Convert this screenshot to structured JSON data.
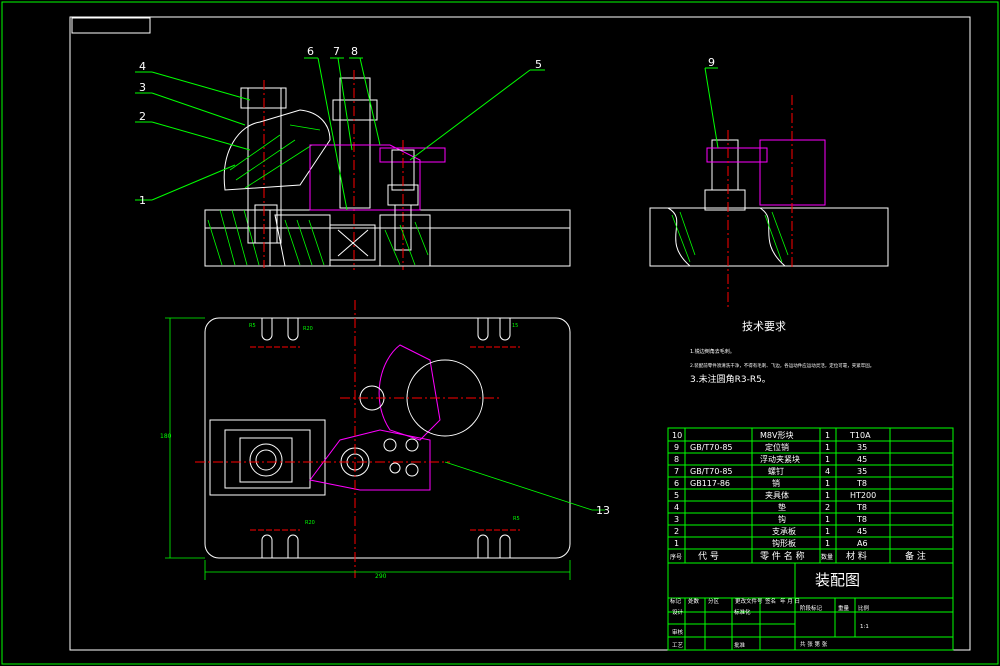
{
  "drawing_title": "装配图",
  "balloons": [
    "1",
    "2",
    "3",
    "4",
    "5",
    "6",
    "7",
    "8",
    "9",
    "13"
  ],
  "tech_requirements": {
    "heading": "技术要求",
    "items": [
      "1.锐边倒角去毛刺。",
      "2.装配前零件须清洗干净，不得有毛刺、飞边，各运动件应运动灵活，定位可靠，夹紧牢固。",
      "3.未注圆角R3-R5。"
    ]
  },
  "dimensions": {
    "width": "290",
    "height": "180",
    "slot_a": "R5",
    "slot_b": "R20",
    "slot_c": "15"
  },
  "bom": {
    "rows": [
      {
        "no": "10",
        "code": "",
        "name": "M8V形块",
        "qty": "1",
        "material": "T10A",
        "note": ""
      },
      {
        "no": "9",
        "code": "GB/T70-85",
        "name": "定位销",
        "qty": "1",
        "material": "35",
        "note": ""
      },
      {
        "no": "8",
        "code": "",
        "name": "浮动夹紧块",
        "qty": "1",
        "material": "45",
        "note": ""
      },
      {
        "no": "7",
        "code": "GB/T70-85",
        "name": "螺钉",
        "qty": "4",
        "material": "35",
        "note": ""
      },
      {
        "no": "6",
        "code": "GB117-86",
        "name": "销",
        "qty": "1",
        "material": "T8",
        "note": ""
      },
      {
        "no": "5",
        "code": "",
        "name": "夹具体",
        "qty": "1",
        "material": "HT200",
        "note": ""
      },
      {
        "no": "4",
        "code": "",
        "name": "垫",
        "qty": "2",
        "material": "T8",
        "note": ""
      },
      {
        "no": "3",
        "code": "",
        "name": "钩",
        "qty": "1",
        "material": "T8",
        "note": ""
      },
      {
        "no": "2",
        "code": "",
        "name": "支承板",
        "qty": "1",
        "material": "45",
        "note": ""
      },
      {
        "no": "1",
        "code": "",
        "name": "钩形板",
        "qty": "1",
        "material": "A6",
        "note": ""
      }
    ],
    "header": {
      "no": "序号",
      "code": "代  号",
      "name": "零 件 名 称",
      "qty": "数量",
      "material": "材  料",
      "note": "备  注"
    }
  },
  "title_block": {
    "row1": [
      "标记",
      "处数",
      "分区",
      "更改文件号",
      "签名",
      "年 月 日"
    ],
    "design": "设计",
    "standard": "标准化",
    "check": "审核",
    "process": "工艺",
    "approve": "批准",
    "stage": "阶段标记",
    "weight": "重量",
    "scale": "比例",
    "scale_val": "1:1",
    "sheets": "共    张    第    张"
  },
  "colors": {
    "background": "#000000",
    "lines": "#ffffff",
    "frame": "#00ff00",
    "leaders": "#00ff00",
    "centerlines": "#ff0000",
    "hatch": "#00ff00",
    "parts": "#ff00ff",
    "dims": "#00ff00",
    "table": "#00ff00"
  }
}
